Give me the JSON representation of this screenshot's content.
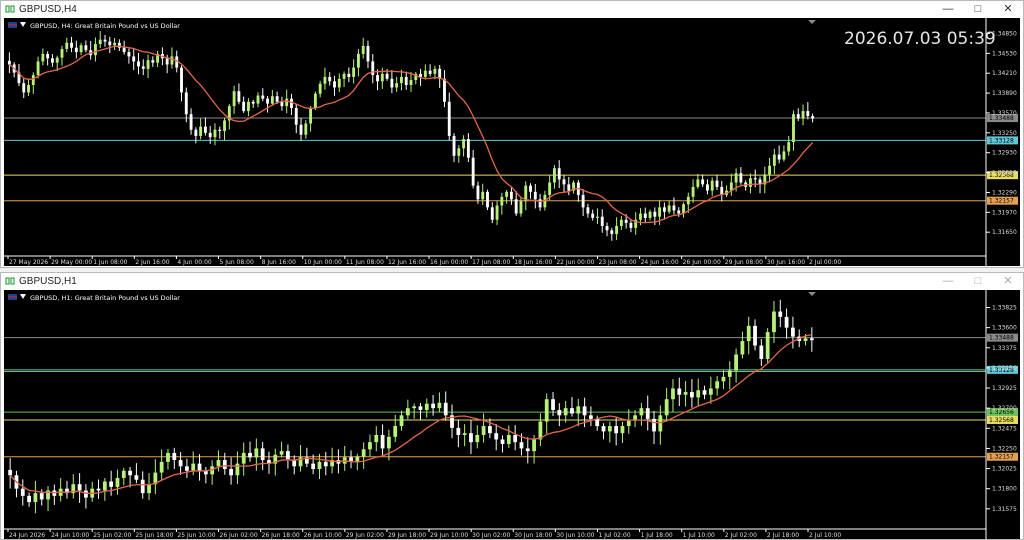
{
  "colors": {
    "background": "#000000",
    "bull": "#b6f27a",
    "bear": "#ffffff",
    "ma": "#e4664a",
    "grid_text": "#dddddd",
    "line_gray": "#8a8a8a",
    "line_cyan": "#62c8d8",
    "line_yellow": "#e8dc60",
    "line_orange": "#e3a052",
    "line_green": "#6cc25a"
  },
  "top_window": {
    "title": "GBPUSD,H4",
    "chart_header": "GBPUSD, H4:  Great Britain Pound vs US Dollar",
    "clock": "2026.07.03 05:39",
    "price_scale": [
      "1.34850",
      "1.34530",
      "1.34210",
      "1.33890",
      "1.33570",
      "1.33250",
      "1.32930",
      "1.32610",
      "1.32290",
      "1.31970",
      "1.31650"
    ],
    "price_range": [
      1.3146,
      1.3497
    ],
    "time_labels": [
      "27 May 2026",
      "29 May 00:00",
      "1 Jun 08:00",
      "2 Jun 16:00",
      "4 Jun 00:00",
      "5 Jun 08:00",
      "8 Jun 16:00",
      "10 Jun 00:00",
      "11 Jun 08:00",
      "12 Jun 16:00",
      "16 Jun 00:00",
      "17 Jun 08:00",
      "18 Jun 16:00",
      "22 Jun 00:00",
      "23 Jun 08:00",
      "24 Jun 16:00",
      "26 Jun 00:00",
      "29 Jun 08:00",
      "30 Jun 16:00",
      "2 Jul 00:00"
    ],
    "levels": [
      {
        "price": 1.33488,
        "label": "1.33488",
        "kind": "gray"
      },
      {
        "price": 1.33128,
        "label": "1.33128",
        "kind": "cyan"
      },
      {
        "price": 1.32568,
        "label": "1.32568",
        "kind": "yellow"
      },
      {
        "price": 1.32157,
        "label": "1.32157",
        "kind": "orange"
      }
    ],
    "close_path": [
      1.3435,
      1.3422,
      1.3405,
      1.339,
      1.3402,
      1.3418,
      1.344,
      1.3452,
      1.3445,
      1.3438,
      1.3446,
      1.346,
      1.347,
      1.3462,
      1.3455,
      1.3466,
      1.3458,
      1.345,
      1.3468,
      1.3475,
      1.3472,
      1.3466,
      1.347,
      1.3462,
      1.3455,
      1.3448,
      1.344,
      1.3432,
      1.3428,
      1.3442,
      1.3438,
      1.3452,
      1.3445,
      1.3435,
      1.3448,
      1.343,
      1.339,
      1.3355,
      1.333,
      1.332,
      1.3335,
      1.3325,
      1.3318,
      1.333,
      1.3328,
      1.3345,
      1.3368,
      1.3392,
      1.3375,
      1.336,
      1.3375,
      1.3372,
      1.3385,
      1.338,
      1.3372,
      1.3384,
      1.3375,
      1.3368,
      1.338,
      1.3365,
      1.3338,
      1.3322,
      1.334,
      1.3365,
      1.3388,
      1.3404,
      1.3415,
      1.3408,
      1.3398,
      1.3412,
      1.342,
      1.3415,
      1.343,
      1.3452,
      1.3465,
      1.344,
      1.3418,
      1.3408,
      1.342,
      1.3412,
      1.3398,
      1.3405,
      1.3415,
      1.3402,
      1.341,
      1.342,
      1.3415,
      1.3425,
      1.342,
      1.3428,
      1.3412,
      1.3375,
      1.332,
      1.3288,
      1.33,
      1.3315,
      1.3285,
      1.324,
      1.3218,
      1.323,
      1.3205,
      1.3185,
      1.3208,
      1.3222,
      1.323,
      1.3218,
      1.3195,
      1.3215,
      1.324,
      1.323,
      1.3218,
      1.3205,
      1.3225,
      1.3245,
      1.3268,
      1.325,
      1.3242,
      1.3232,
      1.3245,
      1.3225,
      1.3205,
      1.3195,
      1.3188,
      1.319,
      1.3175,
      1.3168,
      1.3162,
      1.3175,
      1.3185,
      1.318,
      1.3172,
      1.3185,
      1.3195,
      1.3188,
      1.3198,
      1.319,
      1.3205,
      1.3198,
      1.3208,
      1.32,
      1.3195,
      1.321,
      1.3222,
      1.3238,
      1.325,
      1.3242,
      1.3232,
      1.3248,
      1.3238,
      1.3225,
      1.3232,
      1.3245,
      1.326,
      1.3245,
      1.3238,
      1.3252,
      1.325,
      1.3242,
      1.3258,
      1.3272,
      1.329,
      1.3282,
      1.3295,
      1.331,
      1.3355,
      1.3348,
      1.336,
      1.3352,
      1.3348
    ]
  },
  "bottom_window": {
    "title": "GBPUSD,H1",
    "chart_header": "GBPUSD, H1:  Great Britain Pound vs US Dollar",
    "price_scale": [
      "1.33825",
      "1.33600",
      "1.33375",
      "1.33150",
      "1.32925",
      "1.32700",
      "1.32475",
      "1.32250",
      "1.32025",
      "1.31800",
      "1.31575"
    ],
    "price_range": [
      1.3145,
      1.3392
    ],
    "time_labels": [
      "24 Jun 2026",
      "24 Jun 10:00",
      "25 Jun 02:00",
      "25 Jun 18:00",
      "25 Jun 10:00",
      "26 Jun 02:00",
      "26 Jun 18:00",
      "26 Jun 10:00",
      "29 Jun 02:00",
      "29 Jun 18:00",
      "29 Jun 10:00",
      "30 Jun 02:00",
      "30 Jun 18:00",
      "30 Jun 10:00",
      "1 Jul 02:00",
      "1 Jul 18:00",
      "1 Jul 10:00",
      "2 Jul 02:00",
      "2 Jul 18:00",
      "2 Jul 10:00"
    ],
    "levels": [
      {
        "price": 1.33488,
        "label": "1.33488",
        "kind": "gray"
      },
      {
        "price": 1.33128,
        "label": "1.33128",
        "kind": "cyan"
      },
      {
        "price": 1.3311,
        "label": "",
        "kind": "green"
      },
      {
        "price": 1.32656,
        "label": "1.32656",
        "kind": "green"
      },
      {
        "price": 1.32568,
        "label": "1.32568",
        "kind": "yellow"
      },
      {
        "price": 1.32157,
        "label": "1.32157",
        "kind": "orange"
      }
    ],
    "close_path": [
      1.3195,
      1.318,
      1.3172,
      1.3165,
      1.3175,
      1.3168,
      1.3178,
      1.3172,
      1.318,
      1.3175,
      1.3185,
      1.3178,
      1.317,
      1.318,
      1.3178,
      1.3188,
      1.3182,
      1.3192,
      1.32,
      1.3195,
      1.319,
      1.3175,
      1.3185,
      1.3198,
      1.321,
      1.322,
      1.3212,
      1.3205,
      1.32,
      1.3208,
      1.32,
      1.3196,
      1.3205,
      1.3212,
      1.3202,
      1.3195,
      1.3208,
      1.322,
      1.3215,
      1.3225,
      1.3212,
      1.3208,
      1.3218,
      1.3222,
      1.3212,
      1.3205,
      1.3215,
      1.3208,
      1.3202,
      1.321,
      1.3205,
      1.3212,
      1.3208,
      1.3215,
      1.321,
      1.3216,
      1.3224,
      1.3232,
      1.324,
      1.3225,
      1.3238,
      1.325,
      1.3262,
      1.327,
      1.3272,
      1.3268,
      1.3275,
      1.327,
      1.3276,
      1.3262,
      1.3248,
      1.324,
      1.3242,
      1.3232,
      1.324,
      1.325,
      1.3242,
      1.3235,
      1.323,
      1.324,
      1.3232,
      1.3225,
      1.3222,
      1.3235,
      1.3255,
      1.328,
      1.3268,
      1.3262,
      1.327,
      1.3264,
      1.3272,
      1.3262,
      1.3258,
      1.325,
      1.3244,
      1.325,
      1.3242,
      1.325,
      1.3256,
      1.3262,
      1.327,
      1.3258,
      1.3244,
      1.3262,
      1.328,
      1.3292,
      1.3285,
      1.3288,
      1.3282,
      1.329,
      1.3285,
      1.3292,
      1.33,
      1.3305,
      1.3312,
      1.333,
      1.3345,
      1.3362,
      1.334,
      1.3325,
      1.3355,
      1.3378,
      1.3372,
      1.336,
      1.335,
      1.3345,
      1.3348,
      1.3346
    ]
  }
}
